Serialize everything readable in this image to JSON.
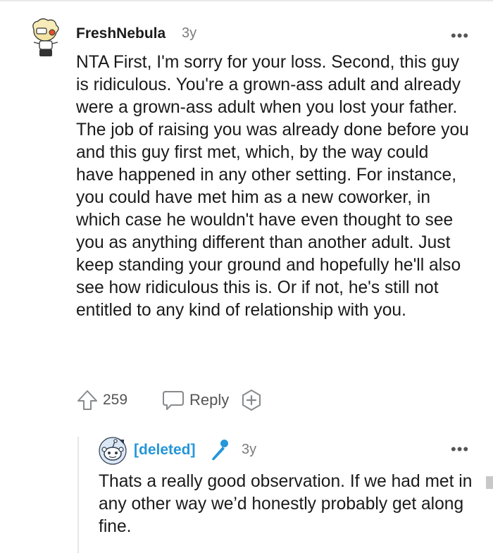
{
  "parent": {
    "username": "FreshNebula",
    "age": "3y",
    "more_icon": "more-horizontal-icon",
    "body": "NTA First, I'm sorry for your loss. Second, this guy is ridiculous. You're a grown-ass adult and already were a grown-ass adult when you lost your father. The job of raising you was already done before you and this guy first met, which, by the way could have happened in any other setting. For instance, you could have met him as a new coworker, in which case he wouldn't have even thought to see you as anything different than another adult. Just keep standing your ground and hopefully he'll also see how ridiculous this is. Or if not, he's still not entitled to any kind of relationship with you.",
    "vote_count": "259",
    "reply_label": "Reply"
  },
  "reply": {
    "username": "[deleted]",
    "age": "3y",
    "body": "Thats a really good observation. If we had met in any other way we’d honestly probably get along fine."
  },
  "colors": {
    "username_deleted": "#2596d8",
    "meta_gray": "#7c7c7c",
    "text": "#1a1a1b"
  }
}
